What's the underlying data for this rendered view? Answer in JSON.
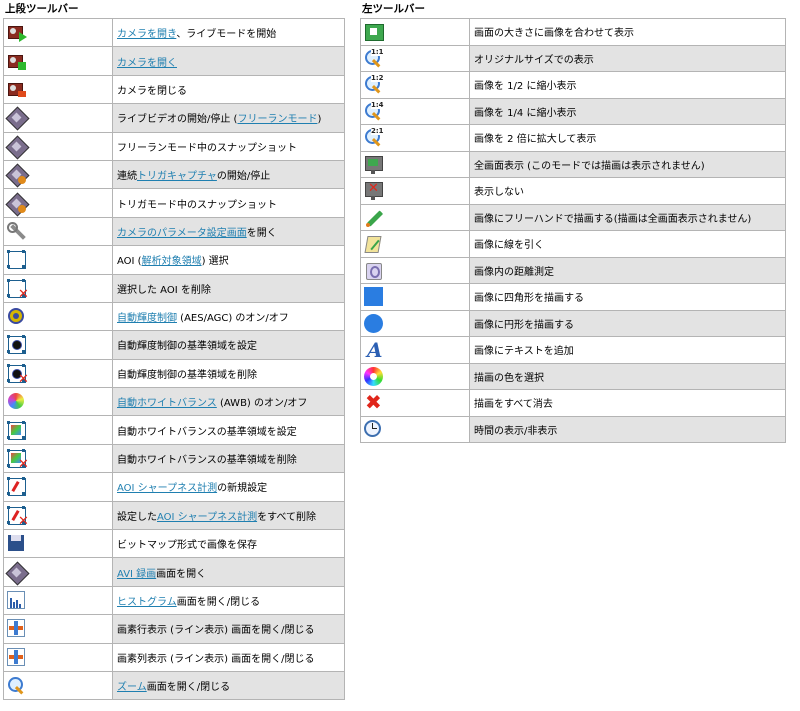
{
  "top_toolbar": {
    "heading": "上段ツールバー",
    "rows": [
      {
        "pre": "",
        "link": "カメラを開き",
        "post": "、ライブモードを開始",
        "icon": "camera-open-live-icon"
      },
      {
        "pre": "",
        "link": "カメラを開く",
        "post": "",
        "icon": "camera-open-icon"
      },
      {
        "pre": "カメラを閉じる",
        "link": "",
        "post": "",
        "icon": "camera-close-icon"
      },
      {
        "pre": "ライブビデオの開始/停止 (",
        "link": "フリーランモード",
        "post": ")",
        "icon": "live-video-icon"
      },
      {
        "pre": "フリーランモード中のスナップショット",
        "link": "",
        "post": "",
        "icon": "snapshot-icon"
      },
      {
        "pre": "連続",
        "link": "トリガキャプチャ",
        "post": "の開始/停止",
        "icon": "trigger-capture-icon"
      },
      {
        "pre": "トリガモード中のスナップショット",
        "link": "",
        "post": "",
        "icon": "trigger-snapshot-icon"
      },
      {
        "pre": "",
        "link": "カメラのパラメータ設定画面",
        "post": "を開く",
        "icon": "wrench-icon"
      },
      {
        "pre": "AOI (",
        "link": "解析対象領域",
        "post": ") 選択",
        "icon": "aoi-select-icon"
      },
      {
        "pre": "選択した AOI を削除",
        "link": "",
        "post": "",
        "icon": "aoi-delete-icon"
      },
      {
        "pre": "",
        "link": "自動輝度制御",
        "post": " (AES/AGC) のオン/オフ",
        "icon": "auto-brightness-icon"
      },
      {
        "pre": "自動輝度制御の基準領域を設定",
        "link": "",
        "post": "",
        "icon": "brightness-area-set-icon"
      },
      {
        "pre": "自動輝度制御の基準領域を削除",
        "link": "",
        "post": "",
        "icon": "brightness-area-delete-icon"
      },
      {
        "pre": "",
        "link": "自動ホワイトバランス",
        "post": " (AWB) のオン/オフ",
        "icon": "auto-white-balance-icon"
      },
      {
        "pre": "自動ホワイトバランスの基準領域を設定",
        "link": "",
        "post": "",
        "icon": "wb-area-set-icon"
      },
      {
        "pre": "自動ホワイトバランスの基準領域を削除",
        "link": "",
        "post": "",
        "icon": "wb-area-delete-icon"
      },
      {
        "pre": "",
        "link": "AOI シャープネス計測",
        "post": "の新規設定",
        "icon": "sharpness-new-icon"
      },
      {
        "pre": "設定した",
        "link": "AOI シャープネス計測",
        "post": "をすべて削除",
        "icon": "sharpness-delete-icon"
      },
      {
        "pre": "ビットマップ形式で画像を保存",
        "link": "",
        "post": "",
        "icon": "save-icon"
      },
      {
        "pre": "",
        "link": "AVI 録画",
        "post": "画面を開く",
        "icon": "avi-record-icon"
      },
      {
        "pre": "",
        "link": "ヒストグラム",
        "post": "画面を開く/閉じる",
        "icon": "histogram-icon"
      },
      {
        "pre": "画素行表示 (ライン表示) 画面を開く/閉じる",
        "link": "",
        "post": "",
        "icon": "line-view-icon"
      },
      {
        "pre": "画素列表示 (ライン表示) 画面を開く/閉じる",
        "link": "",
        "post": "",
        "icon": "column-view-icon"
      },
      {
        "pre": "",
        "link": "ズーム",
        "post": "画面を開く/閉じる",
        "icon": "zoom-icon"
      }
    ]
  },
  "left_toolbar": {
    "heading": "左ツールバー",
    "rows": [
      {
        "text": "画面の大きさに画像を合わせて表示",
        "icon": "fit-to-window-icon",
        "label": ""
      },
      {
        "text": "オリジナルサイズでの表示",
        "icon": "zoom-1-1-icon",
        "label": "1:1"
      },
      {
        "text": "画像を 1/2 に縮小表示",
        "icon": "zoom-1-2-icon",
        "label": "1:2"
      },
      {
        "text": "画像を 1/4 に縮小表示",
        "icon": "zoom-1-4-icon",
        "label": "1:4"
      },
      {
        "text": "画像を 2 倍に拡大して表示",
        "icon": "zoom-2-1-icon",
        "label": "2:1"
      },
      {
        "text": "全画面表示 (このモードでは描画は表示されません)",
        "icon": "fullscreen-icon",
        "label": ""
      },
      {
        "text": "表示しない",
        "icon": "no-display-icon",
        "label": ""
      },
      {
        "text": "画像にフリーハンドで描画する(描画は全画面表示されません)",
        "icon": "pencil-icon",
        "label": ""
      },
      {
        "text": "画像に線を引く",
        "icon": "line-draw-icon",
        "label": ""
      },
      {
        "text": "画像内の距離測定",
        "icon": "measure-icon",
        "label": ""
      },
      {
        "text": "画像に四角形を描画する",
        "icon": "rectangle-icon",
        "label": ""
      },
      {
        "text": "画像に円形を描画する",
        "icon": "circle-icon",
        "label": ""
      },
      {
        "text": "画像にテキストを追加",
        "icon": "text-icon",
        "label": "A"
      },
      {
        "text": "描画の色を選択",
        "icon": "color-wheel-icon",
        "label": ""
      },
      {
        "text": "描画をすべて消去",
        "icon": "clear-all-icon",
        "label": ""
      },
      {
        "text": "時間の表示/非表示",
        "icon": "clock-icon",
        "label": ""
      }
    ]
  }
}
